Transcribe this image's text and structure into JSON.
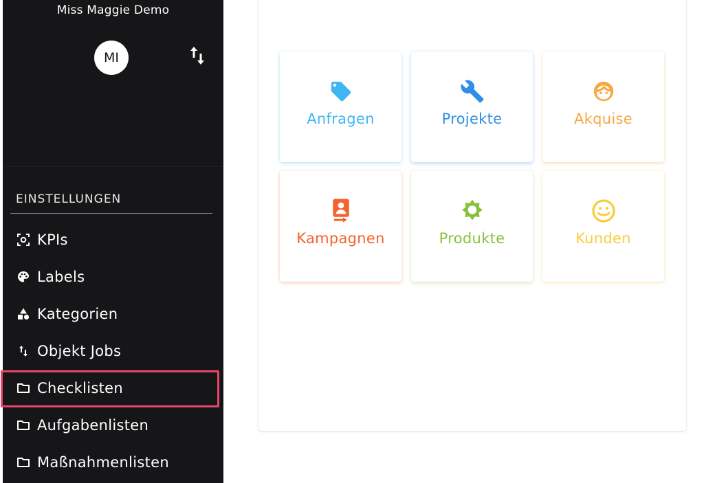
{
  "sidebar": {
    "org_name": "Miss Maggie Demo",
    "avatar_initials": "MI",
    "section_heading": "EINSTELLUNGEN",
    "items": [
      {
        "label": "KPIs",
        "icon": "kpi-scan-icon"
      },
      {
        "label": "Labels",
        "icon": "palette-icon"
      },
      {
        "label": "Kategorien",
        "icon": "shapes-icon"
      },
      {
        "label": "Objekt Jobs",
        "icon": "sort-arrows-icon"
      },
      {
        "label": "Checklisten",
        "icon": "folder-icon",
        "highlighted": true
      },
      {
        "label": "Aufgabenlisten",
        "icon": "folder-icon"
      },
      {
        "label": "Maßnahmenlisten",
        "icon": "folder-icon"
      }
    ]
  },
  "tiles": [
    {
      "label": "Anfragen",
      "icon": "tag-icon",
      "color": "#3fb6f2"
    },
    {
      "label": "Projekte",
      "icon": "wrench-icon",
      "color": "#2e8fe6"
    },
    {
      "label": "Akquise",
      "icon": "face-icon",
      "color": "#f6a742"
    },
    {
      "label": "Kampagnen",
      "icon": "contact-badge-icon",
      "color": "#f4622d"
    },
    {
      "label": "Produkte",
      "icon": "sun-gear-icon",
      "color": "#86c13c"
    },
    {
      "label": "Kunden",
      "icon": "smiley-icon",
      "color": "#f7cd3a"
    }
  ],
  "colors": {
    "sidebar_bg": "#161618",
    "highlight_border": "#e8456a"
  }
}
